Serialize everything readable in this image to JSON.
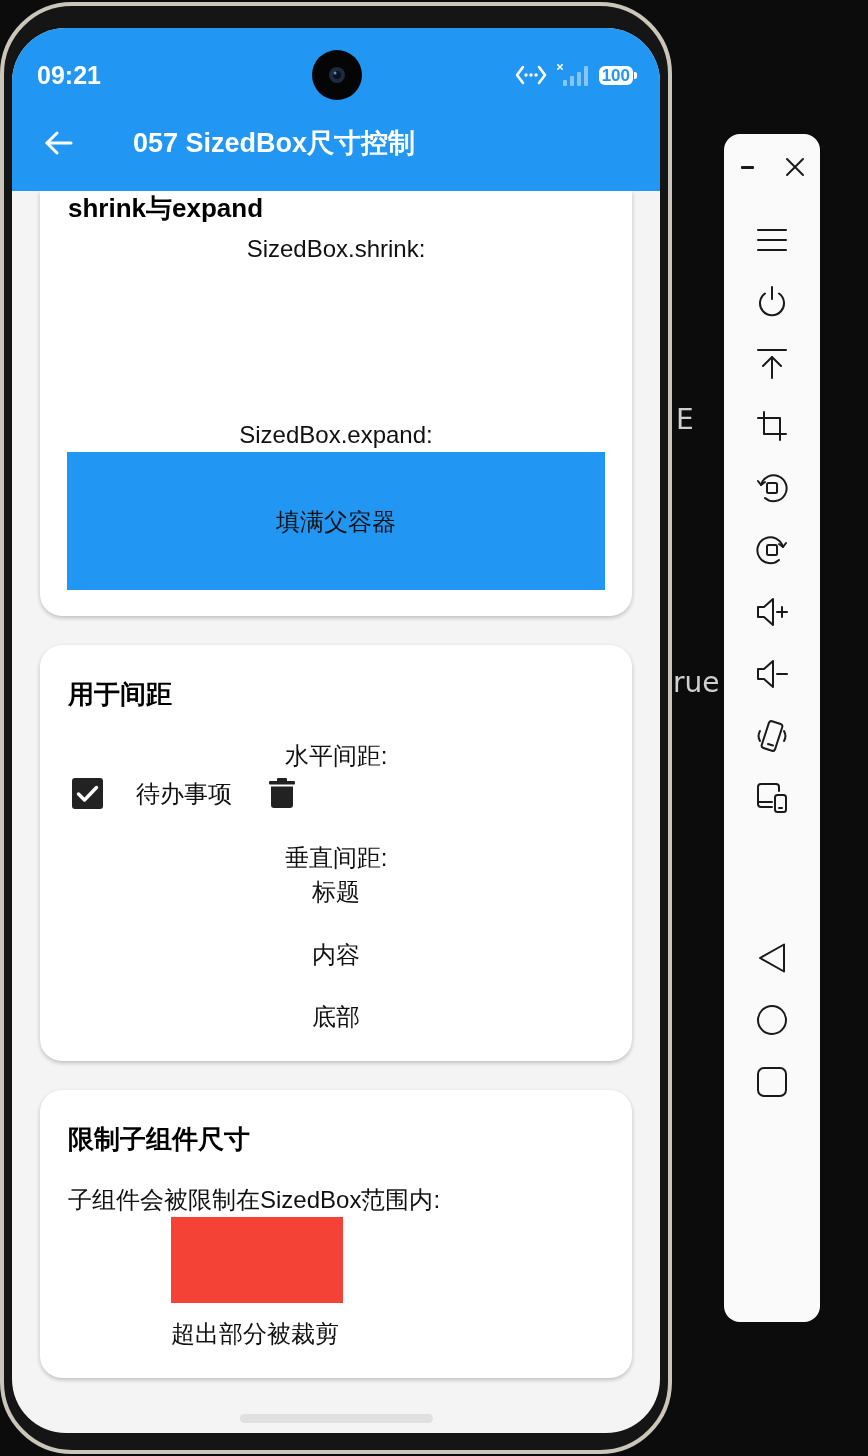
{
  "status_bar": {
    "time": "09:21",
    "battery": "100"
  },
  "app_bar": {
    "title": "057 SizedBox尺寸控制"
  },
  "cards": [
    {
      "kind": "shrink_expand",
      "title": "shrink与expand",
      "shrink_label": "SizedBox.shrink:",
      "expand_label": "SizedBox.expand:",
      "fill_text": "填满父容器"
    },
    {
      "kind": "spacing",
      "title": "用于间距",
      "horizontal_label": "水平间距:",
      "todo": {
        "checked": true,
        "text": "待办事项"
      },
      "vertical_label": "垂直间距:",
      "stack": [
        "标题",
        "内容",
        "底部"
      ]
    },
    {
      "kind": "constrain",
      "title": "限制子组件尺寸",
      "description": "子组件会被限制在SizedBox范围内:",
      "caption": "超出部分被裁剪"
    }
  ],
  "backdrop": {
    "fragments": [
      "E",
      "rue"
    ]
  }
}
